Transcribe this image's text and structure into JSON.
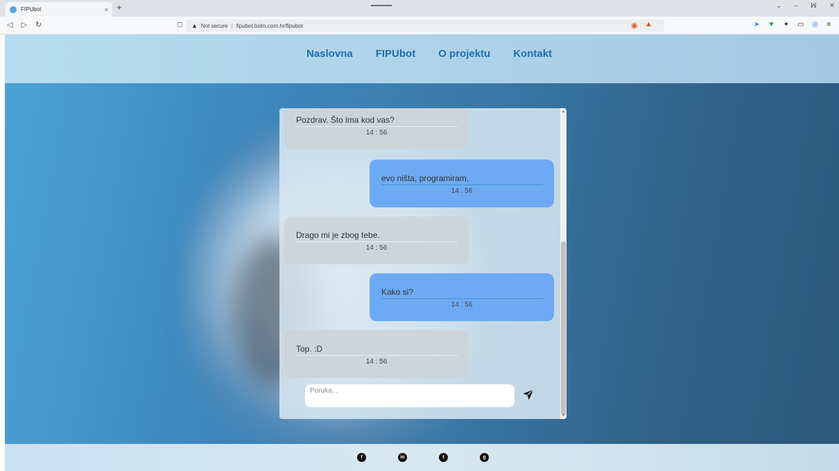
{
  "browser": {
    "tab_title": "FIPUbot",
    "tab_close": "×",
    "new_tab": "+",
    "url_warning": "Not secure",
    "url_separator": "|",
    "url": "fipubot.bslm.com.hr/fipubot",
    "window_controls": [
      "⌄",
      "–",
      "ꟽ",
      "✕"
    ]
  },
  "nav": {
    "items": [
      "Naslovna",
      "FIPUbot",
      "O projektu",
      "Kontakt"
    ]
  },
  "chat": {
    "messages": [
      {
        "from": "bot",
        "text": "Pozdrav. Što ima kod vas?",
        "time": "14 : 56"
      },
      {
        "from": "user",
        "text": "evo ništa, programiram.",
        "time": "14 : 56"
      },
      {
        "from": "bot",
        "text": "Drago mi je zbog tebe.",
        "time": "14 : 56"
      },
      {
        "from": "user",
        "text": "Kako si?",
        "time": "14 : 56"
      },
      {
        "from": "bot",
        "text": "Top. :D",
        "time": "14 : 56"
      }
    ],
    "input_placeholder": "Poruka..."
  },
  "footer": {
    "social_icons": [
      "facebook-icon",
      "linkedin-icon",
      "twitter-icon",
      "github-icon"
    ]
  },
  "colors": {
    "nav_link": "#1f6fb4",
    "user_bubble": "#6eaaf4",
    "bot_bubble": "#cdd2d8"
  }
}
